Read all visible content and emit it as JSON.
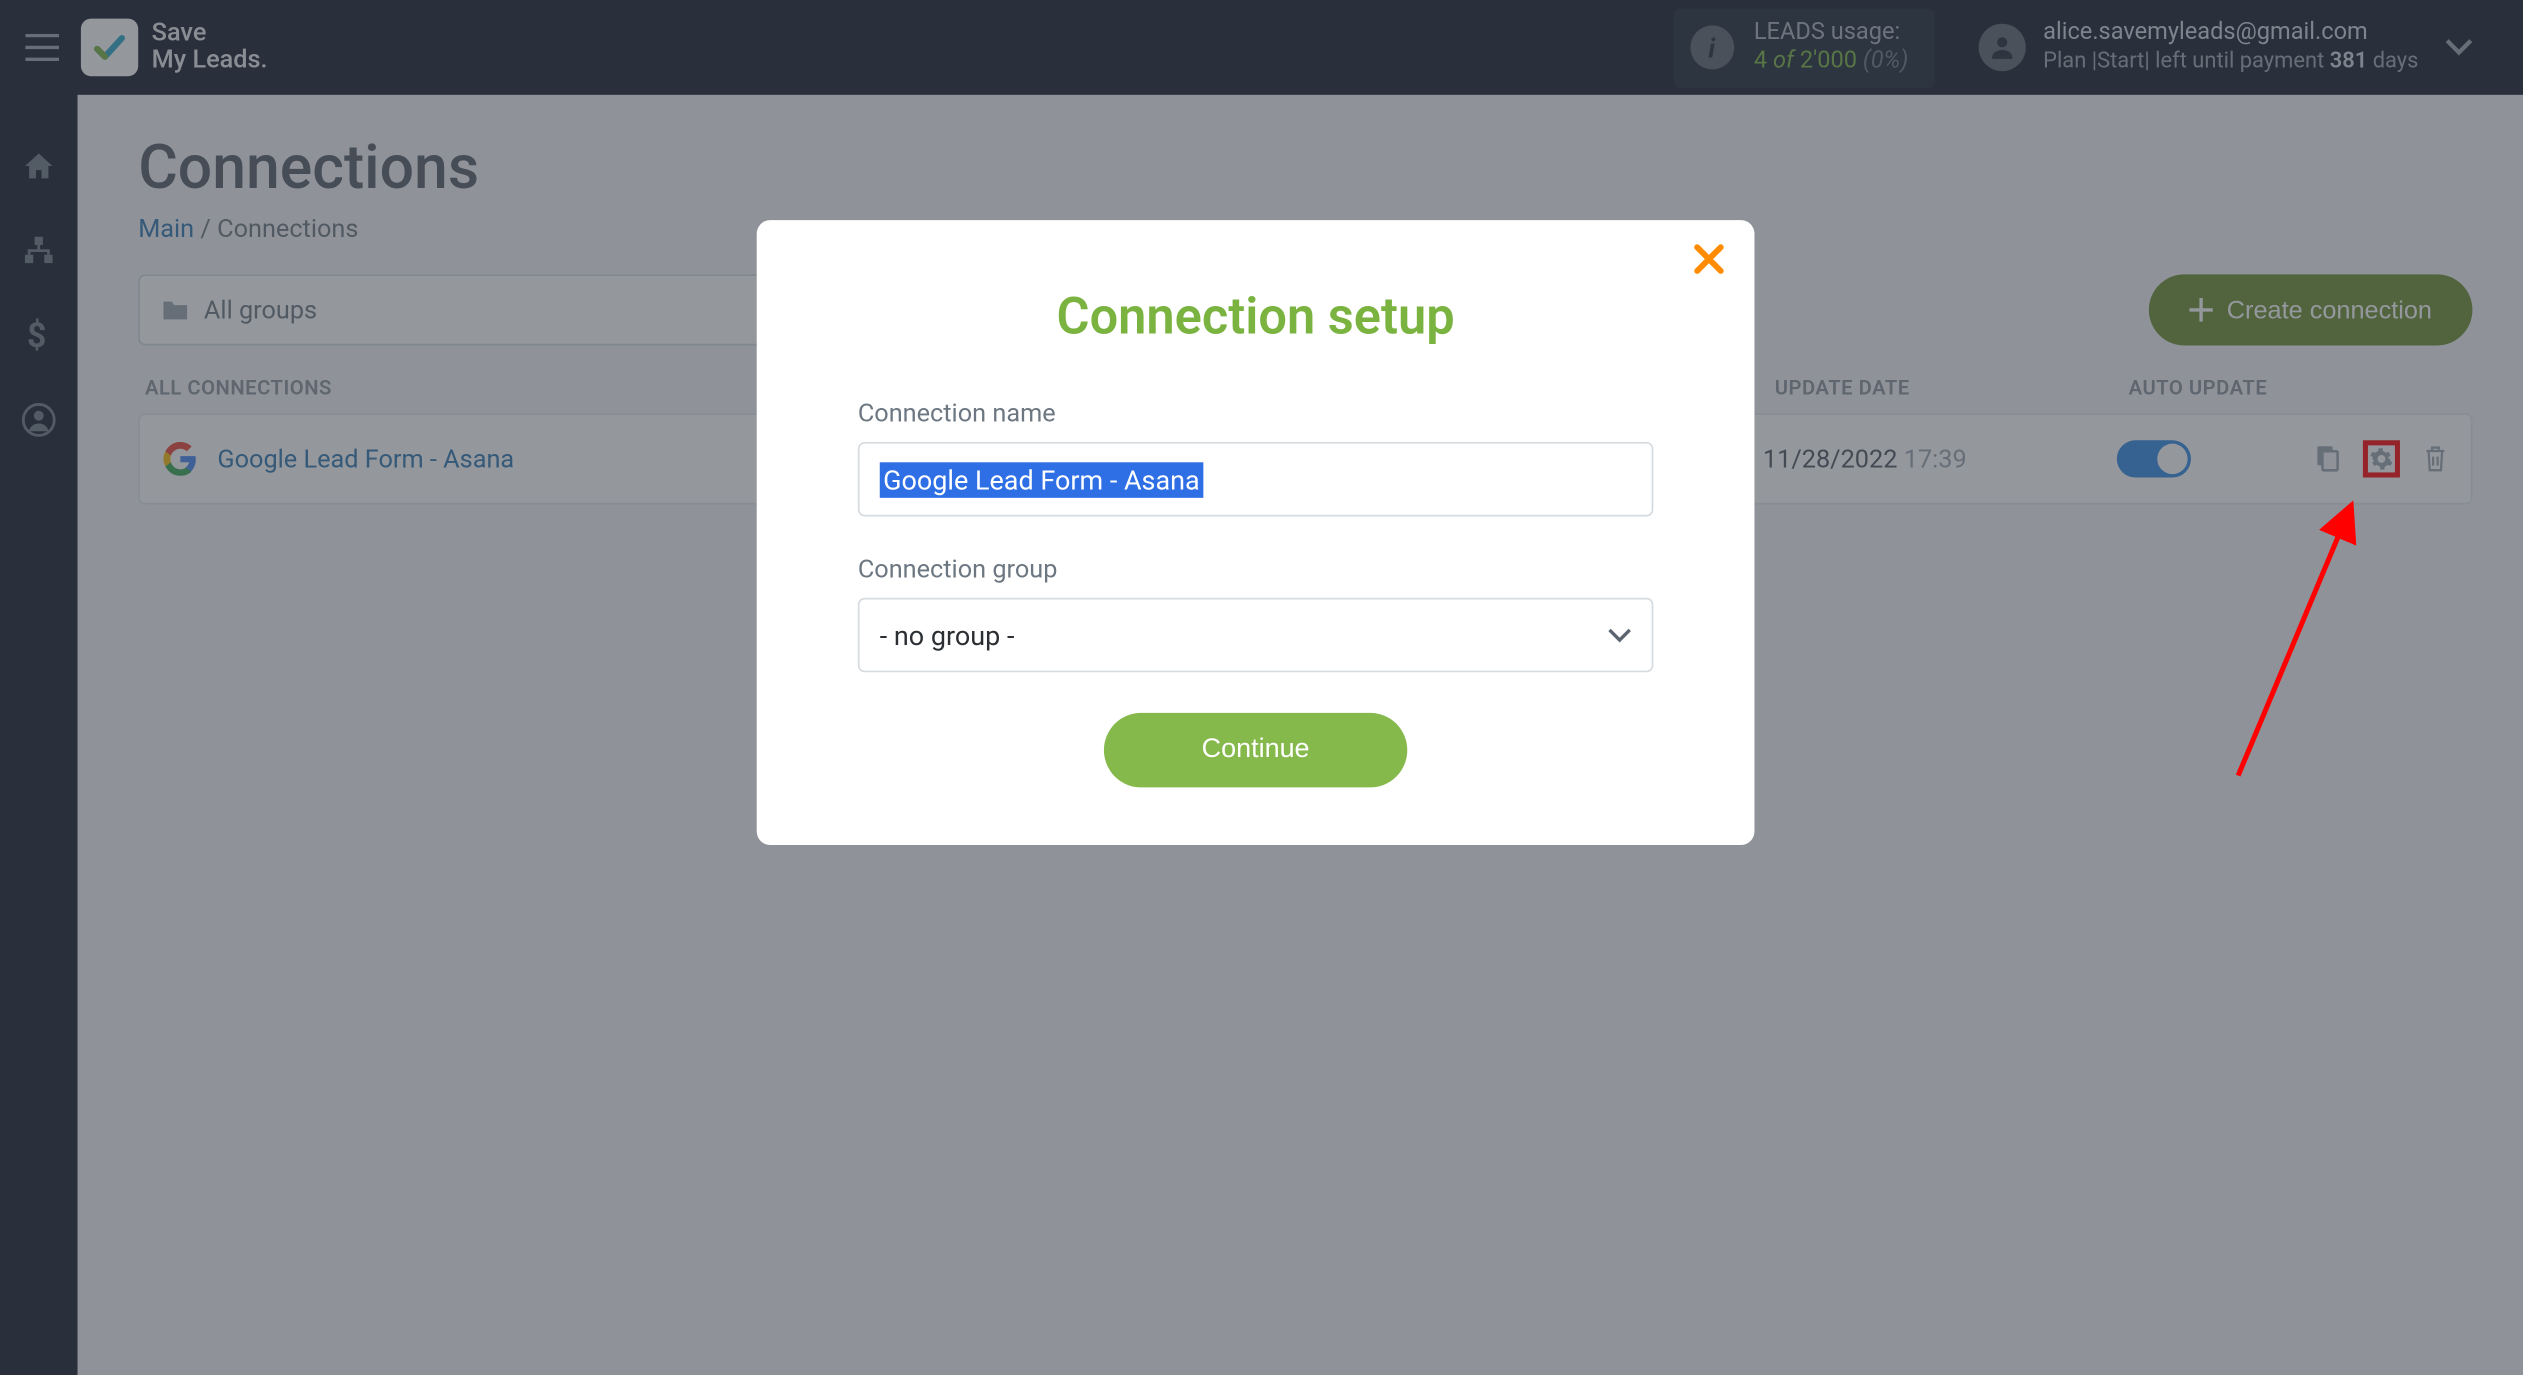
{
  "brand": {
    "line1": "Save",
    "line2": "My Leads."
  },
  "usage": {
    "label": "LEADS usage:",
    "used": "4",
    "of": "of",
    "total": "2'000",
    "pct": "(0%)"
  },
  "account": {
    "email": "alice.savemyleads@gmail.com",
    "plan_prefix": "Plan |",
    "plan_name": "Start",
    "plan_mid": "| left until payment ",
    "days": "381",
    "days_suffix": " days"
  },
  "page": {
    "title": "Connections",
    "breadcrumb_main": "Main",
    "breadcrumb_sep": " / ",
    "breadcrumb_current": "Connections"
  },
  "toolbar": {
    "group_filter": "All groups",
    "create_label": "Create connection"
  },
  "columns": {
    "name": "ALL CONNECTIONS",
    "date": "UPDATE DATE",
    "auto": "AUTO UPDATE"
  },
  "rows": [
    {
      "name": "Google Lead Form - Asana",
      "date": "11/28/2022",
      "time": "17:39"
    }
  ],
  "modal": {
    "title": "Connection setup",
    "name_label": "Connection name",
    "name_value": "Google Lead Form - Asana",
    "group_label": "Connection group",
    "group_value": "- no group -",
    "continue": "Continue"
  }
}
